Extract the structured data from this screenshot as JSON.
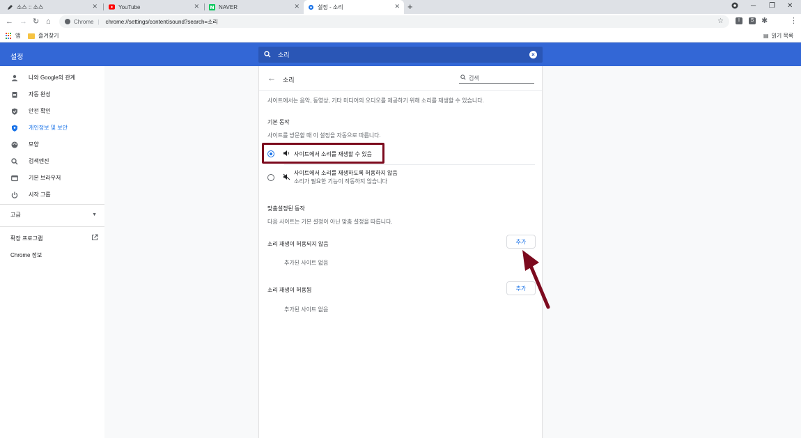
{
  "tabs": [
    {
      "title": "소스 :: 소스",
      "icon": "pencil-icon"
    },
    {
      "title": "YouTube",
      "icon": "youtube-icon"
    },
    {
      "title": "NAVER",
      "icon": "naver-icon"
    },
    {
      "title": "설정 - 소리",
      "icon": "settings-gear-icon"
    }
  ],
  "address": {
    "chip": "Chrome",
    "url": "chrome://settings/content/sound?search=소리"
  },
  "bookmarks": {
    "apps": "앱",
    "folder": "즐겨찾기",
    "reading_list": "읽기 목록"
  },
  "header": {
    "title": "설정",
    "search_value": "소리"
  },
  "sidebar": {
    "items": [
      {
        "label": "나와 Google의 관계"
      },
      {
        "label": "자동 완성"
      },
      {
        "label": "안전 확인"
      },
      {
        "label": "개인정보 및 보안"
      },
      {
        "label": "모양"
      },
      {
        "label": "검색엔진"
      },
      {
        "label": "기본 브라우저"
      },
      {
        "label": "시작 그룹"
      }
    ],
    "advanced": "고급",
    "extensions": "확장 프로그램",
    "about": "Chrome 정보"
  },
  "page": {
    "title": "소리",
    "search_placeholder": "검색",
    "intro": "사이트에서는 음악, 동영상, 기타 미디어의 오디오를 제공하기 위해 소리를 재생할 수 있습니다.",
    "default_heading": "기본 동작",
    "default_desc": "사이트를 방문할 때 이 설정을 자동으로 따릅니다.",
    "option_allow": "사이트에서 소리를 재생할 수 있음",
    "option_block": "사이트에서 소리를 재생하도록 허용하지 않음",
    "option_block_sub": "소리가 필요한 기능이 작동하지 않습니다",
    "custom_heading": "맞춤설정된 동작",
    "custom_desc": "다음 사이트는 기본 설정이 아닌 맞춤 설정을 따릅니다.",
    "not_allowed_label": "소리 재생이 허용되지 않음",
    "allowed_label": "소리 재생이 허용됨",
    "add_button": "추가",
    "empty_text": "추가된 사이트 없음"
  },
  "colors": {
    "accent": "#1a73e8",
    "header": "#3367d6",
    "annotation": "#7c0a1e"
  }
}
